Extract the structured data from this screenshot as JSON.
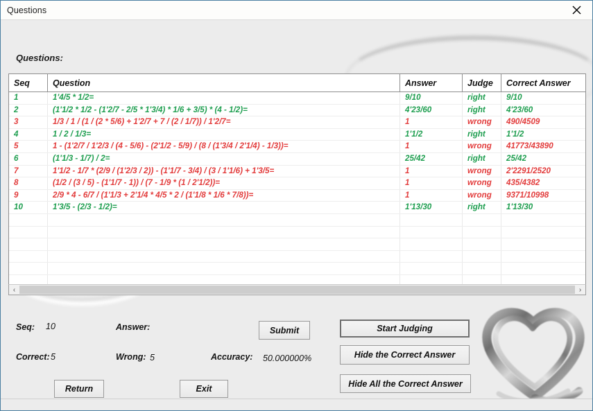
{
  "window": {
    "title": "Questions",
    "close_icon": "close-icon"
  },
  "section": {
    "questions_label": "Questions:"
  },
  "grid": {
    "columns": [
      "Seq",
      "Question",
      "Answer",
      "Judge",
      "Correct Answer"
    ],
    "rows": [
      {
        "seq": "1",
        "question": "1'4/5 * 1/2=",
        "answer": "9/10",
        "judge": "right",
        "correct": "9/10",
        "status": "right"
      },
      {
        "seq": "2",
        "question": "(1'1/2 * 1/2 - (1'2/7 - 2/5 * 1'3/4) * 1/6 + 3/5) * (4 - 1/2)=",
        "answer": "4'23/60",
        "judge": "right",
        "correct": "4'23/60",
        "status": "right"
      },
      {
        "seq": "3",
        "question": "1/3 / 1 / (1 / (2 * 5/6) + 1'2/7 + 7 / (2 / 1/7)) / 1'2/7=",
        "answer": "1",
        "judge": "wrong",
        "correct": "490/4509",
        "status": "wrong"
      },
      {
        "seq": "4",
        "question": "1 / 2 / 1/3=",
        "answer": "1'1/2",
        "judge": "right",
        "correct": "1'1/2",
        "status": "right"
      },
      {
        "seq": "5",
        "question": "1 - (1'2/7 / 1'2/3 / (4 - 5/6) - (2'1/2 - 5/9) / (8 / (1'3/4 / 2'1/4) - 1/3))=",
        "answer": "1",
        "judge": "wrong",
        "correct": "41773/43890",
        "status": "wrong"
      },
      {
        "seq": "6",
        "question": "(1'1/3 - 1/7) / 2=",
        "answer": "25/42",
        "judge": "right",
        "correct": "25/42",
        "status": "right"
      },
      {
        "seq": "7",
        "question": "1'1/2 - 1/7 * (2/9 / (1'2/3 / 2)) - (1'1/7 - 3/4) / (3 / 1'1/6) + 1'3/5=",
        "answer": "1",
        "judge": "wrong",
        "correct": "2'2291/2520",
        "status": "wrong"
      },
      {
        "seq": "8",
        "question": "(1/2 / (3 / 5) - (1'1/7 - 1)) / (7 - 1/9 * (1 / 2'1/2))=",
        "answer": "1",
        "judge": "wrong",
        "correct": "435/4382",
        "status": "wrong"
      },
      {
        "seq": "9",
        "question": "2/9 * 4 - 6/7 / (1'1/3 + 2'1/4 * 4/5 * 2 / (1'1/8 * 1/6 * 7/8))=",
        "answer": "1",
        "judge": "wrong",
        "correct": "9371/10998",
        "status": "wrong"
      },
      {
        "seq": "10",
        "question": "1'3/5 - (2/3 - 1/2)=",
        "answer": "1'13/30",
        "judge": "right",
        "correct": "1'13/30",
        "status": "right"
      }
    ],
    "empty_row_count": 8
  },
  "scrollbar": {
    "left_arrow": "‹",
    "right_arrow": "›"
  },
  "stats": {
    "seq_label": "Seq:",
    "seq_value": "10",
    "answer_label": "Answer:",
    "answer_value": "",
    "correct_label": "Correct:",
    "correct_value": "5",
    "wrong_label": "Wrong:",
    "wrong_value": "5",
    "accuracy_label": "Accuracy:",
    "accuracy_value": "50.000000%"
  },
  "buttons": {
    "submit": "Submit",
    "return": "Return",
    "exit": "Exit",
    "start_judging": "Start Judging",
    "hide_correct_answer": "Hide the Correct Answer",
    "hide_all_correct_answer": "Hide All the Correct Answer"
  },
  "colors": {
    "right": "#1e9e4f",
    "wrong": "#e23b3b",
    "title_border": "#4a7ea1",
    "client_bg": "#ececec"
  },
  "logo": {
    "name": "heart-logo"
  }
}
